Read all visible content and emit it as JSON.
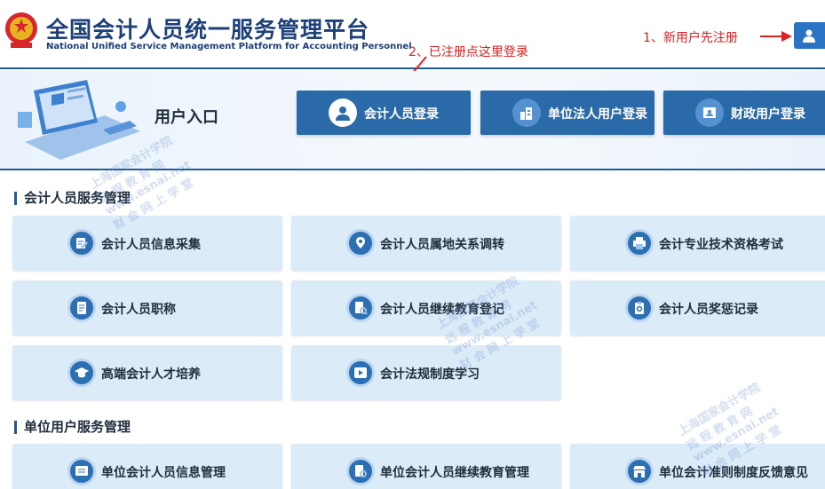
{
  "header": {
    "title_cn": "全国会计人员统一服务管理平台",
    "title_en": "National Unified Service Management Platform for Accounting Personnel",
    "note_register": "1、新用户先注册",
    "note_login": "2、已注册点这里登录",
    "user_icon": "user-icon"
  },
  "entry": {
    "label": "用户入口",
    "buttons": [
      {
        "label": "会计人员登录",
        "icon": "person-icon"
      },
      {
        "label": "单位法人用户登录",
        "icon": "building-icon"
      },
      {
        "label": "财政用户登录",
        "icon": "id-card-icon"
      }
    ]
  },
  "sections": [
    {
      "title": "会计人员服务管理",
      "items": [
        {
          "label": "会计人员信息采集"
        },
        {
          "label": "会计人员属地关系调转"
        },
        {
          "label": "会计专业技术资格考试"
        },
        {
          "label": "会计人员职称"
        },
        {
          "label": "会计人员继续教育登记"
        },
        {
          "label": "会计人员奖惩记录"
        },
        {
          "label": "高端会计人才培养"
        },
        {
          "label": "会计法规制度学习"
        }
      ]
    },
    {
      "title": "单位用户服务管理",
      "items": [
        {
          "label": "单位会计人员信息管理"
        },
        {
          "label": "单位会计人员继续教育管理"
        },
        {
          "label": "单位会计准则制度反馈意见"
        }
      ]
    }
  ],
  "watermark": {
    "line1": "上海国家会计学院",
    "line2": "远 程 教 育 网",
    "line3": "www.esnai.net",
    "line4": "财 会 网 上 学 堂"
  },
  "colors": {
    "primary": "#2b6aa8",
    "accent_red": "#e02020",
    "card_bg": "#dcebf8"
  }
}
